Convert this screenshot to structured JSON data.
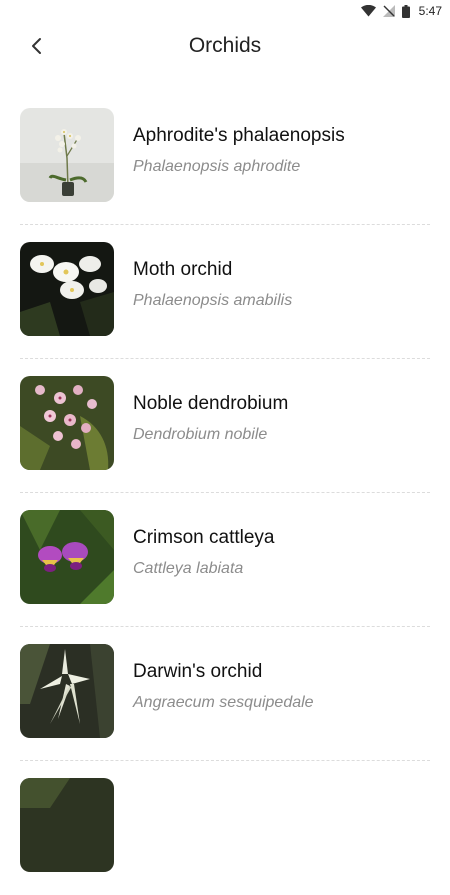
{
  "status_bar": {
    "time": "5:47",
    "icons": [
      "wifi-icon",
      "no-signal-icon",
      "battery-icon"
    ]
  },
  "header": {
    "title": "Orchids",
    "back_icon": "chevron-left-icon"
  },
  "orchids": [
    {
      "common_name": "Aphrodite's phalaenopsis",
      "scientific_name": "Phalaenopsis aphrodite"
    },
    {
      "common_name": "Moth orchid",
      "scientific_name": "Phalaenopsis amabilis"
    },
    {
      "common_name": "Noble dendrobium",
      "scientific_name": "Dendrobium nobile"
    },
    {
      "common_name": "Crimson cattleya",
      "scientific_name": "Cattleya labiata"
    },
    {
      "common_name": "Darwin's orchid",
      "scientific_name": "Angraecum sesquipedale"
    },
    {
      "common_name": "",
      "scientific_name": ""
    }
  ]
}
